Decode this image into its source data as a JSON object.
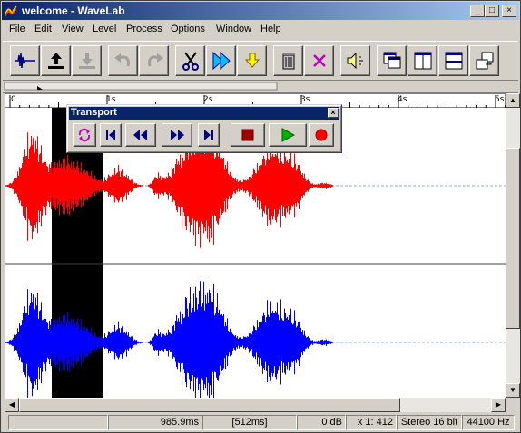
{
  "window": {
    "title": "welcome - WaveLab",
    "controls": {
      "minimize": "_",
      "maximize": "□",
      "close": "×"
    }
  },
  "menu": [
    "File",
    "Edit",
    "View",
    "Level",
    "Process",
    "Options",
    "Window",
    "Help"
  ],
  "toolbar": {
    "buttons": [
      "new-wave-icon",
      "open-icon",
      "save-icon",
      "undo-icon",
      "redo-icon",
      "cut-icon",
      "play-selection-icon",
      "paste-icon",
      "trash-icon",
      "delete-icon",
      "speaker-icon",
      "window-cascade-icon",
      "tile-vertical-icon",
      "tile-horizontal-icon",
      "arrange-icon"
    ]
  },
  "ruler": {
    "labels": [
      "0",
      "1s",
      "2s",
      "3s",
      "4s",
      "5s"
    ]
  },
  "transport": {
    "title": "Transport",
    "close": "×",
    "buttons": [
      "loop-icon",
      "go-to-start-icon",
      "rewind-icon",
      "fast-forward-icon",
      "go-to-end-icon",
      "stop-icon",
      "play-icon",
      "record-icon"
    ]
  },
  "status": {
    "fields": [
      "",
      "985.9ms",
      "[512ms]",
      "0 dB",
      "x 1: 412",
      "Stereo 16 bit",
      "44100 Hz"
    ]
  },
  "colors": {
    "left_channel": "#ff0000",
    "right_channel": "#0000ff",
    "selection": "#000000",
    "title_gradient_start": "#0a246a"
  }
}
